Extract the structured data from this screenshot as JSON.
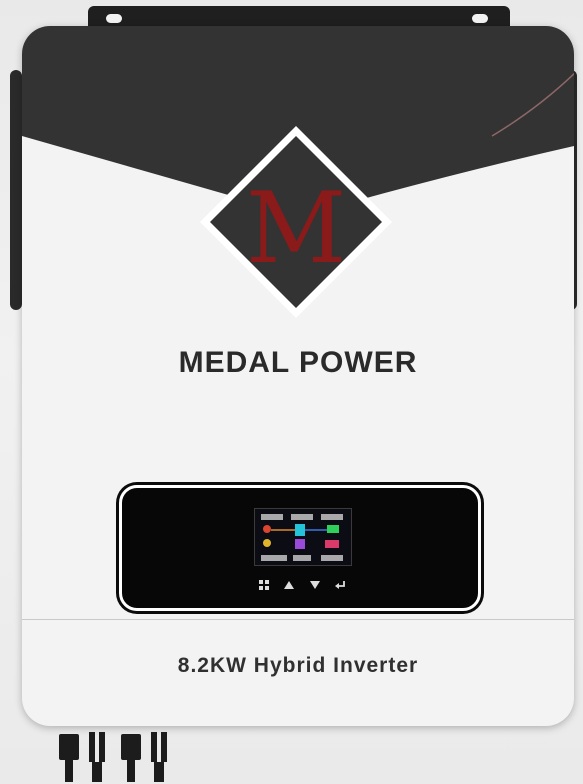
{
  "product": {
    "brand_name": "MEDAL POWER",
    "logo_letter": "M",
    "model_label": "8.2KW  Hybrid  Inverter"
  },
  "display": {
    "buttons": [
      "menu-icon",
      "up-icon",
      "down-icon",
      "enter-icon"
    ]
  },
  "colors": {
    "body": "#f3f3f3",
    "top_panel": "#333333",
    "logo_letter": "#8b1a1a",
    "display": "#070707"
  }
}
